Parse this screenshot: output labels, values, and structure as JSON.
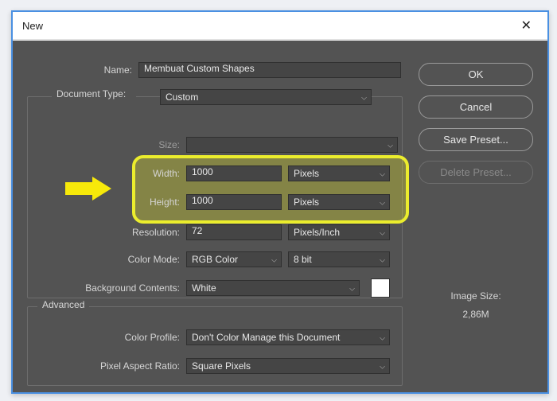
{
  "titlebar": {
    "title": "New"
  },
  "labels": {
    "name": "Name:",
    "doc_type": "Document Type:",
    "size": "Size:",
    "width": "Width:",
    "height": "Height:",
    "resolution": "Resolution:",
    "color_mode": "Color Mode:",
    "bg": "Background Contents:",
    "color_profile": "Color Profile:",
    "par": "Pixel Aspect Ratio:",
    "advanced": "Advanced"
  },
  "values": {
    "name": "Membuat Custom Shapes",
    "doc_type": "Custom",
    "size": "",
    "width": "1000",
    "height": "1000",
    "resolution": "72",
    "width_unit": "Pixels",
    "height_unit": "Pixels",
    "resolution_unit": "Pixels/Inch",
    "color_mode": "RGB Color",
    "bit_depth": "8 bit",
    "bg": "White",
    "color_profile": "Don't Color Manage this Document",
    "par": "Square Pixels"
  },
  "buttons": {
    "ok": "OK",
    "cancel": "Cancel",
    "save_preset": "Save Preset...",
    "delete_preset": "Delete Preset..."
  },
  "image_size": {
    "label": "Image Size:",
    "value": "2,86M"
  }
}
